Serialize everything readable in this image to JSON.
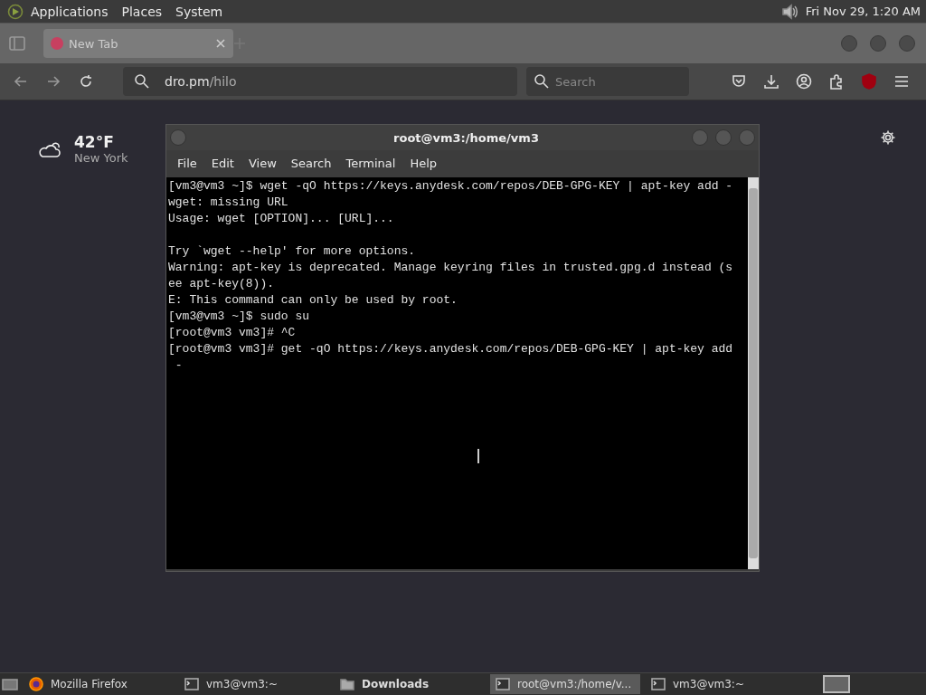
{
  "top_panel": {
    "menus": [
      "Applications",
      "Places",
      "System"
    ],
    "clock": "Fri Nov 29,  1:20 AM"
  },
  "browser": {
    "tabs": [
      {
        "label": "New Tab",
        "selected": true
      }
    ],
    "address": {
      "host": "dro.pm",
      "path": "/hilo"
    },
    "search": {
      "placeholder": "Search"
    },
    "weather": {
      "temperature": "42°F",
      "location": "New York"
    }
  },
  "terminal": {
    "title": "root@vm3:/home/vm3",
    "menus": [
      "File",
      "Edit",
      "View",
      "Search",
      "Terminal",
      "Help"
    ],
    "blocks": [
      [
        "[vm3@vm3 ~]$ wget -qO https://keys.anydesk.com/repos/DEB-GPG-KEY | apt-key add -",
        "wget: missing URL",
        "Usage: wget [OPTION]... [URL]..."
      ],
      [
        "Try `wget --help' for more options.",
        "Warning: apt-key is deprecated. Manage keyring files in trusted.gpg.d instead (s",
        "ee apt-key(8)).",
        "E: This command can only be used by root.",
        "[vm3@vm3 ~]$ sudo su",
        "[root@vm3 vm3]# ^C",
        "[root@vm3 vm3]# get -qO https://keys.anydesk.com/repos/DEB-GPG-KEY | apt-key add",
        " -"
      ]
    ]
  },
  "taskbar": {
    "items": [
      {
        "kind": "firefox",
        "label": "Mozilla Firefox",
        "selected": false
      },
      {
        "kind": "terminal",
        "label": "vm3@vm3:~",
        "selected": false
      },
      {
        "kind": "folder",
        "label": "Downloads",
        "selected": false
      },
      {
        "kind": "terminal",
        "label": "root@vm3:/home/v...",
        "selected": true
      },
      {
        "kind": "terminal",
        "label": "vm3@vm3:~",
        "selected": false
      }
    ]
  }
}
